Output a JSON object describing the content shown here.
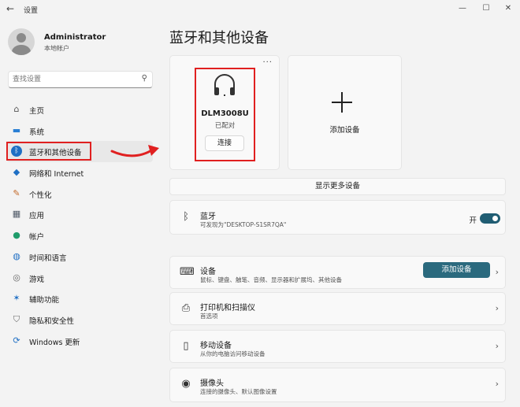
{
  "window": {
    "title": "设置",
    "back_icon": "←",
    "controls": [
      "—",
      "☐",
      "✕"
    ]
  },
  "profile": {
    "name": "Administrator",
    "account_type": "本地帐户"
  },
  "search": {
    "placeholder": "查找设置"
  },
  "sidebar": {
    "items": [
      {
        "label": "主页",
        "icon": "home-icon",
        "glyph": "⌂",
        "color": "#555555"
      },
      {
        "label": "系统",
        "icon": "system-icon",
        "glyph": "▬",
        "color": "#2a7fd4"
      },
      {
        "label": "蓝牙和其他设备",
        "icon": "bluetooth-icon",
        "glyph": "ᛒ",
        "color": "#ffffff",
        "active": true
      },
      {
        "label": "网络和 Internet",
        "icon": "wifi-icon",
        "glyph": "◆",
        "color": "#1f6fc4"
      },
      {
        "label": "个性化",
        "icon": "brush-icon",
        "glyph": "✎",
        "color": "#c46a2a"
      },
      {
        "label": "应用",
        "icon": "apps-icon",
        "glyph": "▦",
        "color": "#505a68"
      },
      {
        "label": "帐户",
        "icon": "account-icon",
        "glyph": "●",
        "color": "#1f9c6b"
      },
      {
        "label": "时间和语言",
        "icon": "globe-icon",
        "glyph": "◍",
        "color": "#1f6fc4"
      },
      {
        "label": "游戏",
        "icon": "gamepad-icon",
        "glyph": "◎",
        "color": "#666666"
      },
      {
        "label": "辅助功能",
        "icon": "accessibility-icon",
        "glyph": "✶",
        "color": "#1f6fc4"
      },
      {
        "label": "隐私和安全性",
        "icon": "shield-icon",
        "glyph": "⛉",
        "color": "#6a6a6a"
      },
      {
        "label": "Windows 更新",
        "icon": "update-icon",
        "glyph": "⟳",
        "color": "#1f6fc4"
      }
    ]
  },
  "main": {
    "title": "蓝牙和其他设备",
    "device_card": {
      "name": "DLM3008U",
      "status": "已配对",
      "connect_label": "连接",
      "more_label": "...",
      "icon": "headphones-icon"
    },
    "add_card": {
      "label": "添加设备",
      "icon": "plus-icon"
    },
    "show_more_label": "显示更多设备",
    "bluetooth_row": {
      "title": "蓝牙",
      "subtitle": "可发现为\"DESKTOP-S1SR7QA\"",
      "toggle_label": "开",
      "toggle_on": true
    },
    "rows": [
      {
        "title": "设备",
        "subtitle": "鼠标、键盘、触笔、音频、显示器和扩展坞、其他设备",
        "icon": "devices-icon",
        "glyph": "⌨",
        "button": "添加设备"
      },
      {
        "title": "打印机和扫描仪",
        "subtitle": "首选项",
        "icon": "printer-icon",
        "glyph": "⎙"
      },
      {
        "title": "移动设备",
        "subtitle": "从你的电脑访问移动设备",
        "icon": "phone-icon",
        "glyph": "▯"
      },
      {
        "title": "摄像头",
        "subtitle": "连接的摄像头、默认图像设置",
        "icon": "camera-icon",
        "glyph": "◉"
      }
    ]
  },
  "colors": {
    "accent": "#2b6a7e",
    "highlight": "#e02020"
  }
}
